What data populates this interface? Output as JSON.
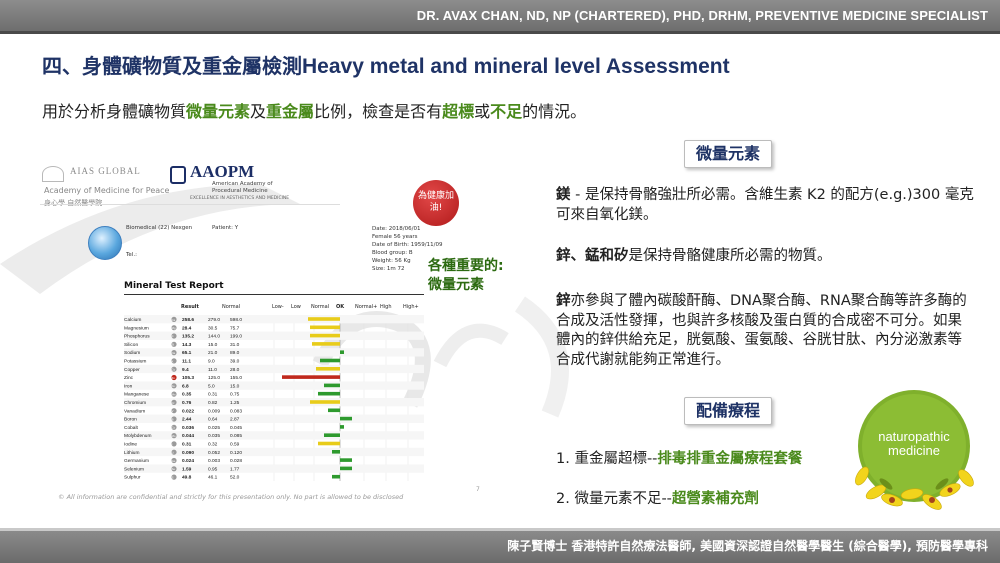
{
  "header": {
    "banner": "DR. AVAX CHAN, ND, NP (CHARTERED),  PHD, DRHM, PREVENTIVE MEDICINE SPECIALIST"
  },
  "title": {
    "zh": "四、身體礦物質及重金屬檢測",
    "en": "Heavy metal and mineral level Assessment"
  },
  "subtitle": {
    "p1": "用於分析身體礦物質",
    "k1": "微量元素",
    "p2": "及",
    "k2": "重金屬",
    "p3": "比例，檢查是否有",
    "k3": "超標",
    "p4": "或",
    "k4": "不足",
    "p5": "的情況。"
  },
  "report": {
    "aias": {
      "name": "AIAS GLOBAL",
      "full": "Academy of Medicine for Peace",
      "cn": "身心學 自然醫學院"
    },
    "aaopm": {
      "name": "AAOPM",
      "sub1": "American Academy of",
      "sub2": "Procedural Medicine",
      "tag": "EXCELLENCE IN AESTHETICS AND MEDICINE"
    },
    "badge": "為健康加油!",
    "patient": {
      "biomedical": "Biomedical (22) Nexgen",
      "patient_id": "Patient: Y",
      "tel": "Tel.:",
      "date": "Date: 2018/06/01",
      "sex_age": "Female 56 years",
      "dob": "Date of Birth: 1959/11/09",
      "blood": "Blood group: B",
      "weight": "Weight: 56 Kg",
      "size": "Size: 1m 72"
    },
    "test_title": "Mineral Test Report",
    "headers": {
      "result": "Result",
      "normal": "Normal",
      "low2": "Low-",
      "low": "Low",
      "nrm": "Normal",
      "ok": "OK",
      "nplus": "Normal+",
      "high": "High",
      "high2": "High+"
    },
    "rows": [
      {
        "name": "Calcium",
        "sym": "Ca",
        "result": "258.6",
        "lo": "279.0",
        "hi": "598.0",
        "dev": -0.8,
        "color": "#e8cc1a"
      },
      {
        "name": "Magnesium",
        "sym": "Mg",
        "result": "28.4",
        "lo": "30.5",
        "hi": "75.7",
        "dev": -0.75,
        "color": "#e8cc1a"
      },
      {
        "name": "Phosphorus",
        "sym": "P",
        "result": "135.2",
        "lo": "144.0",
        "hi": "199.0",
        "dev": -0.75,
        "color": "#e8cc1a"
      },
      {
        "name": "Silicon",
        "sym": "Si",
        "result": "14.3",
        "lo": "15.0",
        "hi": "31.0",
        "dev": -0.7,
        "color": "#e8cc1a"
      },
      {
        "name": "Sodium",
        "sym": "Na",
        "result": "65.1",
        "lo": "21.0",
        "hi": "89.0",
        "dev": 0,
        "color": "#2e9a2e"
      },
      {
        "name": "Potassium",
        "sym": "K",
        "result": "11.1",
        "lo": "9.0",
        "hi": "39.0",
        "dev": -0.5,
        "color": "#2e9a2e"
      },
      {
        "name": "Copper",
        "sym": "Cu",
        "result": "9.4",
        "lo": "11.0",
        "hi": "28.0",
        "dev": -0.6,
        "color": "#e8cc1a"
      },
      {
        "name": "Zinc",
        "sym": "Zn",
        "result": "105.3",
        "lo": "125.0",
        "hi": "155.0",
        "dev": -1.45,
        "color": "#c0281c"
      },
      {
        "name": "Iron",
        "sym": "Fe",
        "result": "6.8",
        "lo": "5.0",
        "hi": "15.0",
        "dev": -0.4,
        "color": "#2e9a2e"
      },
      {
        "name": "Manganese",
        "sym": "Mn",
        "result": "0.35",
        "lo": "0.31",
        "hi": "0.75",
        "dev": -0.55,
        "color": "#2e9a2e"
      },
      {
        "name": "Chromium",
        "sym": "Cr",
        "result": "0.76",
        "lo": "0.82",
        "hi": "1.25",
        "dev": -0.75,
        "color": "#e8cc1a"
      },
      {
        "name": "Vanadium",
        "sym": "V",
        "result": "0.022",
        "lo": "0.009",
        "hi": "0.083",
        "dev": -0.3,
        "color": "#2e9a2e"
      },
      {
        "name": "Boron",
        "sym": "B",
        "result": "2.44",
        "lo": "0.64",
        "hi": "2.87",
        "dev": 0.3,
        "color": "#2e9a2e"
      },
      {
        "name": "Cobalt",
        "sym": "Co",
        "result": "0.036",
        "lo": "0.025",
        "hi": "0.045",
        "dev": 0.05,
        "color": "#2e9a2e"
      },
      {
        "name": "Molybdenum",
        "sym": "Mo",
        "result": "0.044",
        "lo": "0.035",
        "hi": "0.085",
        "dev": -0.4,
        "color": "#2e9a2e"
      },
      {
        "name": "Iodine",
        "sym": "I",
        "result": "0.31",
        "lo": "0.32",
        "hi": "0.59",
        "dev": -0.55,
        "color": "#e8cc1a"
      },
      {
        "name": "Lithium",
        "sym": "Li",
        "result": "0.090",
        "lo": "0.052",
        "hi": "0.120",
        "dev": -0.2,
        "color": "#2e9a2e"
      },
      {
        "name": "Germanium",
        "sym": "Ge",
        "result": "0.024",
        "lo": "0.003",
        "hi": "0.028",
        "dev": 0.3,
        "color": "#2e9a2e"
      },
      {
        "name": "Selenium",
        "sym": "Se",
        "result": "1.59",
        "lo": "0.95",
        "hi": "1.77",
        "dev": 0.3,
        "color": "#2e9a2e"
      },
      {
        "name": "Sulphur",
        "sym": "S",
        "result": "49.8",
        "lo": "46.1",
        "hi": "52.0",
        "dev": -0.2,
        "color": "#2e9a2e"
      }
    ],
    "footer": "© All information are confidential and strictly for this presentation only. No part is allowed to be disclosed",
    "page": "7"
  },
  "annotation": {
    "line1": "各種重要的:",
    "line2": "微量元素"
  },
  "right": {
    "box1": "微量元素",
    "mg_lead": "鎂",
    "mg_text": " - 是保持骨骼強壯所必需。含維生素 K2 的配方(e.g.)300 毫克可來自氧化鎂。",
    "zn_lead": "鋅、錳和矽",
    "zn_text": "是保持骨骼健康所必需的物質。",
    "zn2_lead": "鋅",
    "zn2_text": "亦參與了體內碳酸酐酶、DNA聚合酶、RNA聚合酶等許多酶的合成及活性發揮，也與許多核酸及蛋白質的合成密不可分。如果體內的鋅供給充足，胱氨酸、蛋氨酸、谷胱甘肽、內分泌激素等合成代謝就能夠正常進行。",
    "box2": "配備療程",
    "t1_prefix": "1. 重金屬超標--",
    "t1_key": "排毒排重金屬療程套餐",
    "t2_prefix": "2. 微量元素不足--",
    "t2_key": "超營素補充劑"
  },
  "logo": {
    "line1": "naturopathic",
    "line2": "medicine"
  },
  "footer": {
    "banner": "陳子賢博士 香港特許自然療法醫師, 美國資深認證自然醫學醫生 (綜合醫學), 預防醫學專科"
  }
}
